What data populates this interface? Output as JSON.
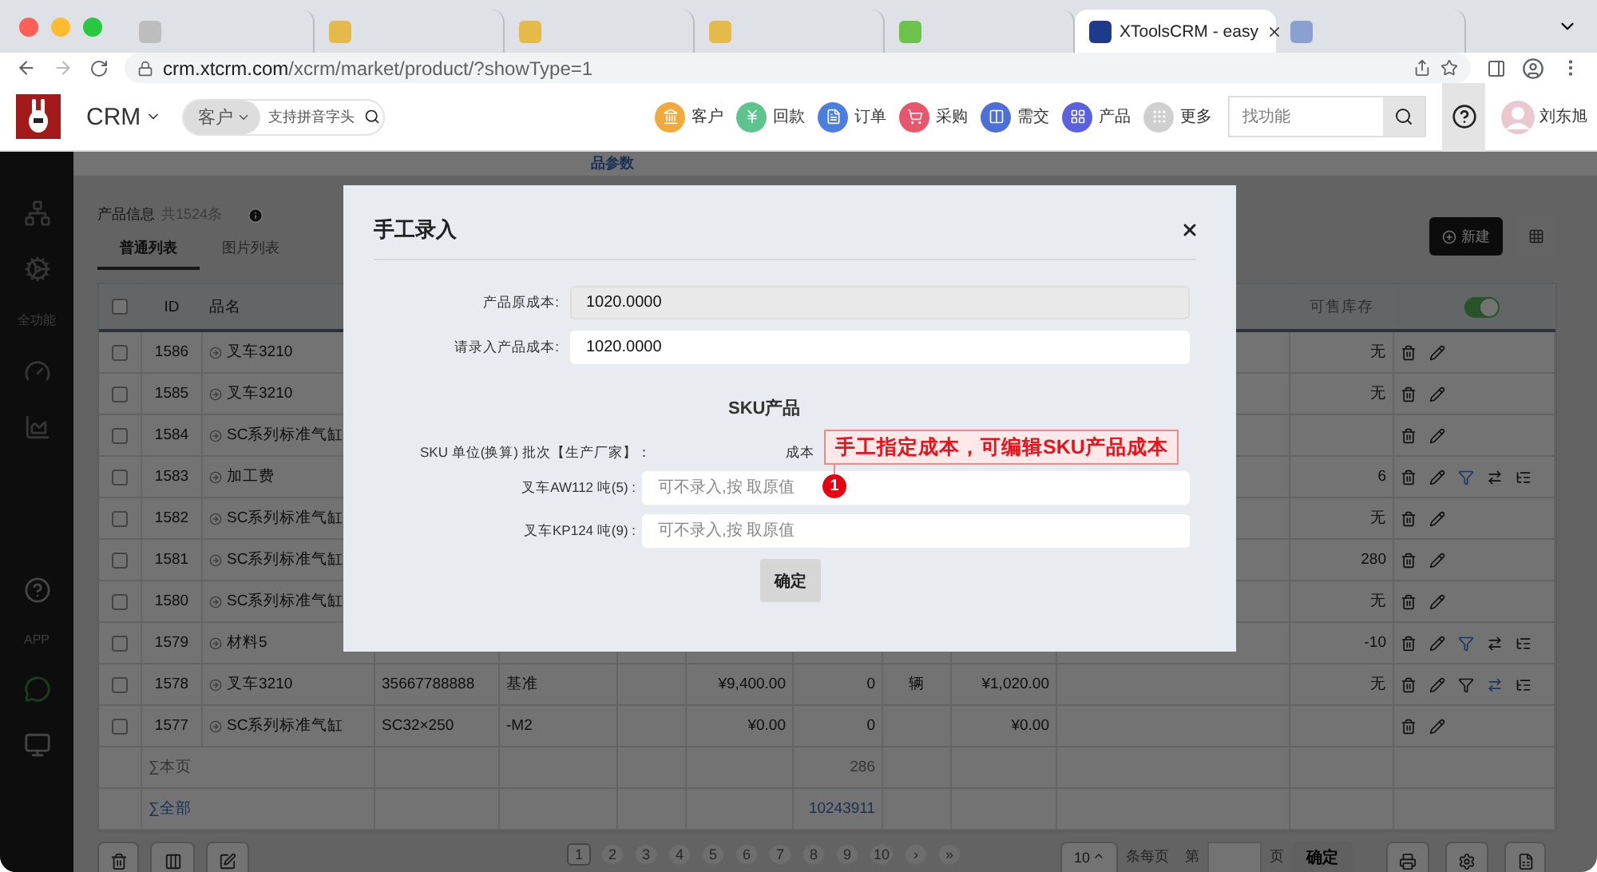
{
  "browser": {
    "tabs": [
      {
        "selected": false,
        "color": "#bdbdbd"
      },
      {
        "selected": false,
        "color": "#e5b94a"
      },
      {
        "selected": false,
        "color": "#e5b94a"
      },
      {
        "selected": false,
        "color": "#e5b94a"
      },
      {
        "selected": false,
        "color": "#6cc24a"
      },
      {
        "selected": true,
        "color": "#1d3b8a",
        "title": "XToolsCRM - easy"
      },
      {
        "selected": false,
        "color": "#8aa0d0"
      }
    ],
    "url": {
      "host": "crm.xtcrm.com",
      "path": "/xcrm/market/product/?showType=1"
    }
  },
  "header": {
    "app": "CRM",
    "search": {
      "scope": "客户",
      "placeholder": "支持拼音字头"
    },
    "shortcuts": [
      {
        "label": "客户",
        "kind": "bank",
        "color": "#f2a93b"
      },
      {
        "label": "回款",
        "kind": "yen",
        "color": "#5ec48e"
      },
      {
        "label": "订单",
        "kind": "order",
        "color": "#4a7fe0"
      },
      {
        "label": "采购",
        "kind": "cart",
        "color": "#e8566c"
      },
      {
        "label": "需交",
        "kind": "columns",
        "color": "#4f6fd8"
      },
      {
        "label": "产品",
        "kind": "grid",
        "color": "#5b5fe0"
      },
      {
        "label": "更多",
        "kind": "more",
        "color": "#cfcfcf"
      }
    ],
    "find": {
      "placeholder": "找功能"
    },
    "user": "刘东旭"
  },
  "sidebar": {
    "top": [
      {
        "kind": "network"
      },
      {
        "kind": "gears"
      },
      {
        "kind": "text",
        "label": "全功能"
      },
      {
        "kind": "gauge"
      },
      {
        "kind": "chart"
      }
    ],
    "bottom": [
      {
        "kind": "help"
      },
      {
        "kind": "text",
        "label": "APP"
      },
      {
        "kind": "chat"
      },
      {
        "kind": "monitor"
      }
    ]
  },
  "page": {
    "section_tab": "品参数",
    "title": "产品信息",
    "count": "共1524条",
    "view_tabs": [
      {
        "label": "普通列表",
        "selected": true
      },
      {
        "label": "图片列表",
        "selected": false
      }
    ],
    "new_button": "新建"
  },
  "table": {
    "header": {
      "all_checked": false,
      "id": "ID",
      "name": "品名",
      "stock": "可售库存",
      "stock_toggle_on": true
    },
    "rows": [
      {
        "checked": false,
        "id": "1586",
        "name": "叉车3210",
        "stock": "无",
        "actions": [
          {
            "kind": "trash",
            "highlighted": false
          },
          {
            "kind": "edit",
            "highlighted": false
          }
        ]
      },
      {
        "checked": false,
        "id": "1585",
        "name": "叉车3210",
        "stock": "无",
        "actions": [
          {
            "kind": "trash",
            "highlighted": false
          },
          {
            "kind": "edit",
            "highlighted": false
          }
        ]
      },
      {
        "checked": false,
        "id": "1584",
        "name": "SC系列标准气缸",
        "actions": [
          {
            "kind": "trash",
            "highlighted": false
          },
          {
            "kind": "edit",
            "highlighted": false
          }
        ]
      },
      {
        "checked": false,
        "id": "1583",
        "name": "加工费",
        "stock": "6",
        "actions": [
          {
            "kind": "trash",
            "highlighted": false
          },
          {
            "kind": "edit",
            "highlighted": false
          },
          {
            "kind": "funnel",
            "highlighted": true
          },
          {
            "kind": "swap",
            "highlighted": false
          },
          {
            "kind": "tree",
            "highlighted": false
          }
        ]
      },
      {
        "checked": false,
        "id": "1582",
        "name": "SC系列标准气缸",
        "stock": "无",
        "actions": [
          {
            "kind": "trash",
            "highlighted": false
          },
          {
            "kind": "edit",
            "highlighted": false
          }
        ]
      },
      {
        "checked": false,
        "id": "1581",
        "name": "SC系列标准气缸",
        "stock": "280",
        "actions": [
          {
            "kind": "trash",
            "highlighted": false
          },
          {
            "kind": "edit",
            "highlighted": false
          }
        ]
      },
      {
        "checked": false,
        "id": "1580",
        "name": "SC系列标准气缸",
        "stock": "无",
        "actions": [
          {
            "kind": "trash",
            "highlighted": false
          },
          {
            "kind": "edit",
            "highlighted": false
          }
        ]
      },
      {
        "checked": false,
        "id": "1579",
        "name": "材料5",
        "stock": "-10",
        "actions": [
          {
            "kind": "trash",
            "highlighted": false
          },
          {
            "kind": "edit",
            "highlighted": false
          },
          {
            "kind": "funnel",
            "highlighted": true
          },
          {
            "kind": "swap",
            "highlighted": false
          },
          {
            "kind": "tree",
            "highlighted": false
          }
        ]
      },
      {
        "checked": false,
        "id": "1578",
        "name": "叉车3210",
        "code": "35667788888",
        "spec": "基准",
        "price": "¥9,400.00",
        "qty": "0",
        "unit": "辆",
        "cost": "¥1,020.00",
        "stock": "无",
        "actions": [
          {
            "kind": "trash",
            "highlighted": false
          },
          {
            "kind": "edit",
            "highlighted": false
          },
          {
            "kind": "funnel",
            "highlighted": false
          },
          {
            "kind": "swap",
            "highlighted": true
          },
          {
            "kind": "tree",
            "highlighted": false
          }
        ]
      },
      {
        "checked": false,
        "id": "1577",
        "name": "SC系列标准气缸",
        "code": "SC32×250",
        "spec": "-M2",
        "price": "¥0.00",
        "qty": "0",
        "cost": "¥0.00",
        "actions": [
          {
            "kind": "trash",
            "highlighted": false
          },
          {
            "kind": "edit",
            "highlighted": false
          }
        ]
      }
    ],
    "totals": [
      {
        "label": "∑本页",
        "qty": "286",
        "link": false
      },
      {
        "label": "∑全部",
        "qty": "10243911",
        "link": true
      }
    ]
  },
  "footer": {
    "pages": [
      {
        "label": "1",
        "selected": true
      },
      {
        "label": "2",
        "selected": false
      },
      {
        "label": "3",
        "selected": false
      },
      {
        "label": "4",
        "selected": false
      },
      {
        "label": "5",
        "selected": false
      },
      {
        "label": "6",
        "selected": false
      },
      {
        "label": "7",
        "selected": false
      },
      {
        "label": "8",
        "selected": false
      },
      {
        "label": "9",
        "selected": false
      },
      {
        "label": "10",
        "selected": false
      }
    ],
    "next": "›",
    "last": "»",
    "page_size": "10",
    "per_page": "条每页",
    "page_prefix": "第",
    "page_suffix": "页",
    "go": "确定"
  },
  "modal": {
    "title": "手工录入",
    "fields": [
      {
        "label": "产品原成本:",
        "value": "1020.0000",
        "readonly": true
      },
      {
        "label": "请录入产品成本:",
        "value": "1020.0000",
        "readonly": false
      }
    ],
    "sku_title": "SKU产品",
    "sku_header": {
      "label": "SKU 单位(换算) 批次【生产厂家】：",
      "cost": "成本"
    },
    "sku_rows": [
      {
        "label": "叉车AW112 吨(5) :",
        "placeholder": "可不录入,按 取原值"
      },
      {
        "label": "叉车KP124 吨(9) :",
        "placeholder": "可不录入,按 取原值"
      }
    ],
    "confirm": "确定"
  },
  "annotation": {
    "text": "手工指定成本，可编辑SKU产品成本",
    "badge": "1"
  }
}
